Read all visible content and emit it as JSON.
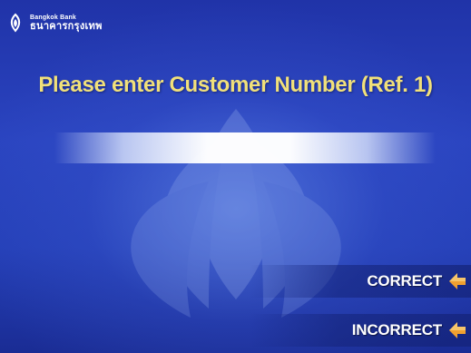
{
  "bank": {
    "name_en": "Bangkok Bank",
    "name_th": "ธนาคารกรุงเทพ",
    "logo_icon": "lotus-logo-icon"
  },
  "screen": {
    "title": "Please enter Customer Number (Ref. 1)",
    "entry_value": ""
  },
  "actions": {
    "correct_label": "CORRECT",
    "incorrect_label": "INCORRECT",
    "arrow_icon": "arrow-left-icon"
  },
  "colors": {
    "background": "#2a44c0",
    "title": "#f1e07a",
    "arrow": "#f0a030"
  }
}
